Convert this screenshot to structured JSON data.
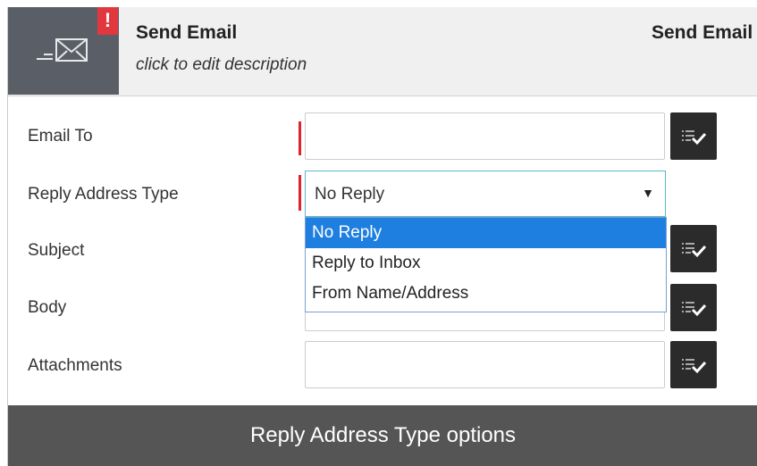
{
  "header": {
    "title": "Send Email",
    "description": "click to edit description",
    "title_right": "Send Email",
    "alert_badge": "!",
    "icon": "send-email-icon"
  },
  "form": {
    "rows": [
      {
        "label": "Email To"
      },
      {
        "label": "Reply Address Type"
      },
      {
        "label": "Subject"
      },
      {
        "label": "Body"
      },
      {
        "label": "Attachments"
      }
    ],
    "reply_type": {
      "selected": "No Reply",
      "options": [
        "No Reply",
        "Reply to Inbox",
        "From Name/Address"
      ]
    },
    "picker_icon": "list-check-icon"
  },
  "caption": "Reply Address Type options",
  "colors": {
    "header_bg": "#f0f0f0",
    "icon_tile": "#5a5e66",
    "alert": "#e2373f",
    "required": "#e2222b",
    "selected_option": "#1e7fe0",
    "focus_border": "#5bb7c9",
    "button": "#2b2b2b",
    "caption_bg": "#555555"
  }
}
